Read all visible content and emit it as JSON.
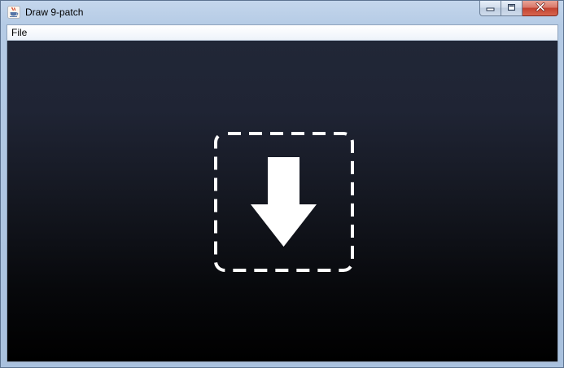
{
  "window": {
    "title": "Draw 9-patch",
    "app_icon": "java-cup-icon",
    "controls": {
      "minimize_icon": "minimize-icon",
      "maximize_icon": "maximize-icon",
      "close_icon": "close-icon"
    }
  },
  "menubar": {
    "items": [
      {
        "label": "File"
      }
    ]
  },
  "content": {
    "drop_zone_icon": "download-arrow-icon",
    "colors": {
      "background_top": "#212737",
      "background_bottom": "#000000",
      "graphic": "#ffffff"
    }
  }
}
